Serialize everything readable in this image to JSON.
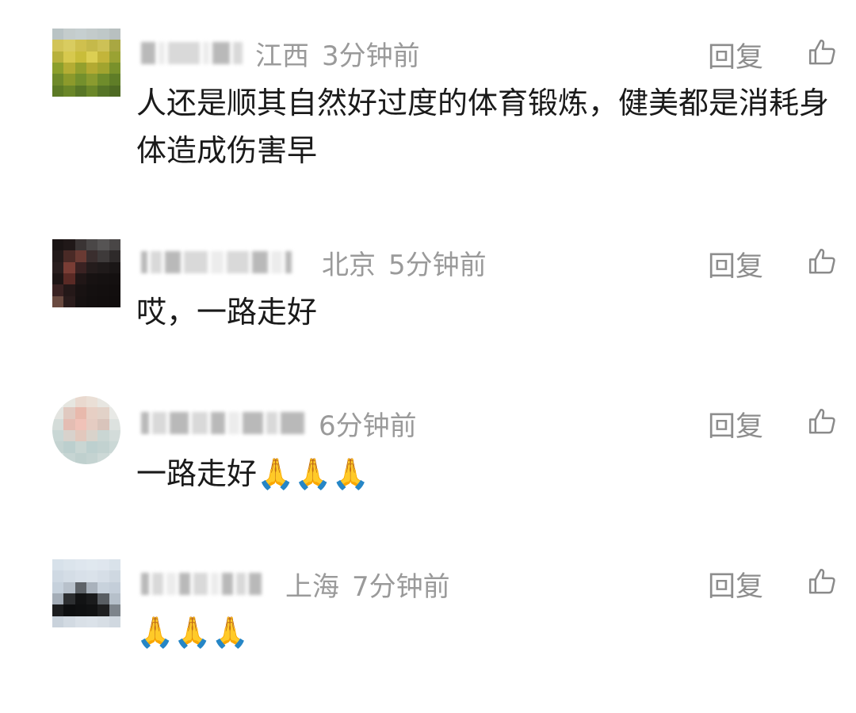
{
  "comments": [
    {
      "location": "江西",
      "time": "3分钟前",
      "reply_label": "回复",
      "text": "人还是顺其自然好过度的体育锻炼，健美都是消耗身体造成伤害早",
      "avatar_icon": "landscape-avatar"
    },
    {
      "location": "北京",
      "time": "5分钟前",
      "reply_label": "回复",
      "text": "哎，一路走好",
      "avatar_icon": "dark-avatar"
    },
    {
      "location": "",
      "time": "6分钟前",
      "reply_label": "回复",
      "text": "一路走好🙏🙏🙏",
      "avatar_icon": "flower-avatar"
    },
    {
      "location": "上海",
      "time": "7分钟前",
      "reply_label": "回复",
      "text": "🙏🙏🙏",
      "avatar_icon": "mountain-avatar"
    }
  ],
  "colors": {
    "meta": "#9a9a9a",
    "reply": "#8d8d8d",
    "text": "#1a1a1a"
  }
}
